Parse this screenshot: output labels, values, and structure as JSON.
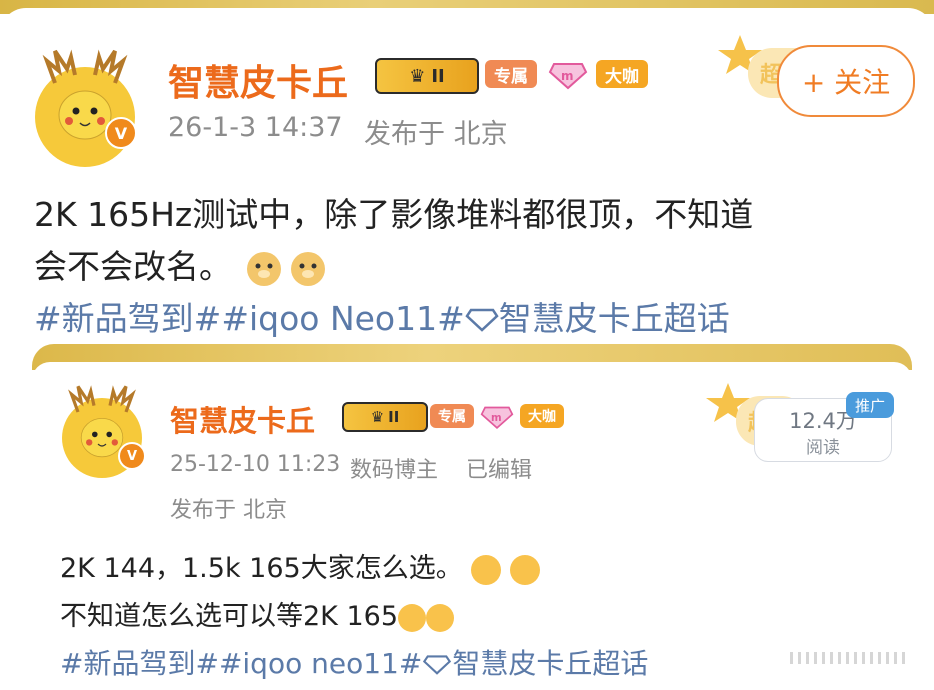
{
  "post": {
    "username": "智慧皮卡丘",
    "level_badge": "II",
    "badges": [
      "专属",
      "大咖"
    ],
    "timestamp": "26-1-3 14:37",
    "location": "发布于 北京",
    "follow_label": "+ 关注",
    "text_line1": "2K 165Hz测试中，除了影像堆料都很顶，不知道",
    "text_line2": "会不会改名。",
    "topics": [
      "#新品驾到#",
      "#iqoo Neo11#",
      "智慧皮卡丘超话"
    ]
  },
  "repost": {
    "username": "智慧皮卡丘",
    "level_badge": "II",
    "badges": [
      "专属",
      "大咖"
    ],
    "timestamp": "25-12-10 11:23",
    "role": "数码博主",
    "edited": "已编辑",
    "location": "发布于 北京",
    "promo_tag": "推广",
    "read_count": "12.4万",
    "read_label": "阅读",
    "text_line1": "2K 144，1.5k 165大家怎么选。",
    "text_line2": "不知道怎么选可以等2K 165",
    "topics": [
      "#新品驾到#",
      "#iqoo neo11#",
      "智慧皮卡丘超话"
    ]
  },
  "colors": {
    "accent_orange": "#ec6a1b",
    "topic_blue": "#5b7aa8",
    "gold_band": "#e2c35e",
    "promo_blue": "#4a9bdc"
  },
  "icons": [
    "pikachu-avatar",
    "verified-v-icon",
    "crown-level-icon",
    "diamond-pink-icon",
    "diamond-topic-icon",
    "doge-emoji",
    "drool-emoji",
    "shy-emoji"
  ]
}
